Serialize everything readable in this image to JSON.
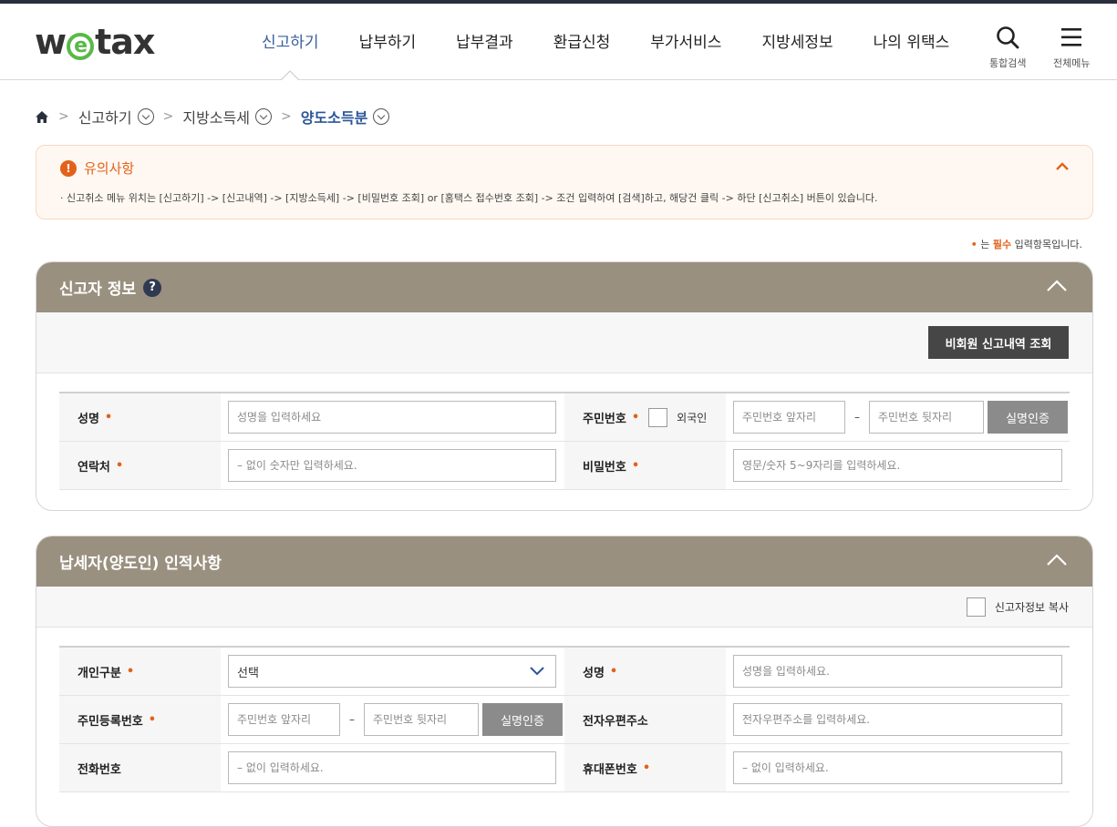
{
  "header": {
    "logo": {
      "pre": "w",
      "mid": "e",
      "post": "tax"
    },
    "nav": [
      "신고하기",
      "납부하기",
      "납부결과",
      "환급신청",
      "부가서비스",
      "지방세정보",
      "나의 위택스"
    ],
    "search_label": "통합검색",
    "menu_label": "전체메뉴"
  },
  "breadcrumb": {
    "items": [
      "신고하기",
      "지방소득세",
      "양도소득분"
    ]
  },
  "notice": {
    "title": "유의사항",
    "body": "· 신고취소 메뉴 위치는 [신고하기] -> [신고내역] -> [지방소득세] -> [비밀번호 조회] or [홈택스 접수번호 조회] -> 조건 입력하여 [검색]하고, 해당건 클릭 -> 하단 [신고취소] 버튼이 있습니다."
  },
  "required_note": {
    "dot": "•",
    "pre": "는",
    "em": "필수",
    "post": "입력항목입니다."
  },
  "reporter": {
    "title": "신고자 정보",
    "help": "?",
    "lookup_button": "비회원 신고내역 조회",
    "name_label": "성명",
    "name_placeholder": "성명을 입력하세요",
    "rrn_label": "주민번호",
    "foreigner_label": "외국인",
    "rrn_front_placeholder": "주민번호 앞자리",
    "rrn_back_placeholder": "주민번호 뒷자리",
    "verify_button": "실명인증",
    "contact_label": "연락처",
    "contact_placeholder": "– 없이 숫자만 입력하세요.",
    "password_label": "비밀번호",
    "password_placeholder": "영문/숫자 5~9자리를 입력하세요."
  },
  "taxpayer": {
    "title": "납세자(양도인) 인적사항",
    "copy_label": "신고자정보 복사",
    "type_label": "개인구분",
    "type_value": "선택",
    "name_label": "성명",
    "name_placeholder": "성명을 입력하세요.",
    "rrn_label": "주민등록번호",
    "rrn_front_placeholder": "주민번호 앞자리",
    "rrn_back_placeholder": "주민번호 뒷자리",
    "verify_button": "실명인증",
    "email_label": "전자우편주소",
    "email_placeholder": "전자우편주소를 입력하세요.",
    "phone_label": "전화번호",
    "phone_placeholder": "– 없이 입력하세요.",
    "mobile_label": "휴대폰번호",
    "mobile_placeholder": "– 없이 입력하세요."
  },
  "req_mark": "•",
  "dash": "–",
  "colors": {
    "accent": "#e2621b",
    "panel_header": "#9a907f",
    "nav_active": "#3b5fa0"
  }
}
